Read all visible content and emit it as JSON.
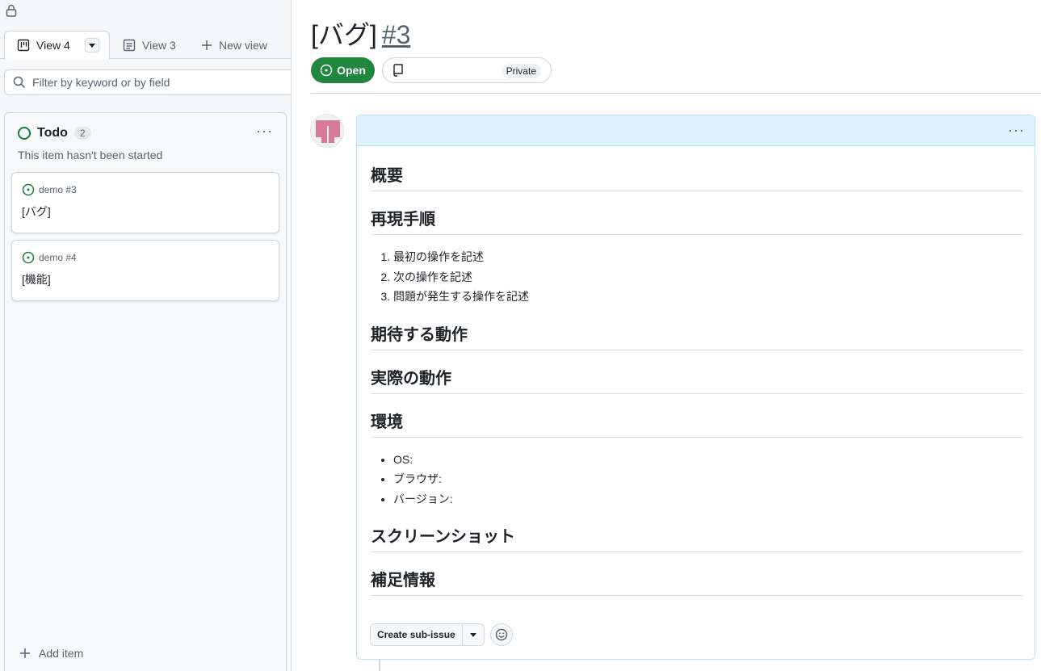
{
  "left_pane": {
    "tabs": [
      {
        "label": "View 4",
        "icon": "board-icon",
        "active": true
      },
      {
        "label": "View 3",
        "icon": "table-icon",
        "active": false
      }
    ],
    "new_view_label": "New view",
    "filter_placeholder": "Filter by keyword or by field",
    "column": {
      "title": "Todo",
      "count": "2",
      "description": "This item hasn't been started",
      "status_color": "#1a7f37",
      "cards": [
        {
          "ref": "demo #3",
          "title": "[バグ]"
        },
        {
          "ref": "demo #4",
          "title": "[機能]"
        }
      ],
      "add_item_label": "Add item"
    }
  },
  "issue": {
    "title": "[バグ]",
    "number": "#3",
    "state_label": "Open",
    "state_color": "#1f883d",
    "visibility_label": "Private",
    "body": {
      "h_overview": "概要",
      "h_repro": "再現手順",
      "repro_steps": [
        "最初の操作を記述",
        "次の操作を記述",
        "問題が発生する操作を記述"
      ],
      "h_expected": "期待する動作",
      "h_actual": "実際の動作",
      "h_env": "環境",
      "env_items": [
        "OS:",
        "ブラウザ:",
        "バージョン:"
      ],
      "h_screenshot": "スクリーンショット",
      "h_notes": "補足情報"
    },
    "create_sub_issue_label": "Create sub-issue"
  }
}
